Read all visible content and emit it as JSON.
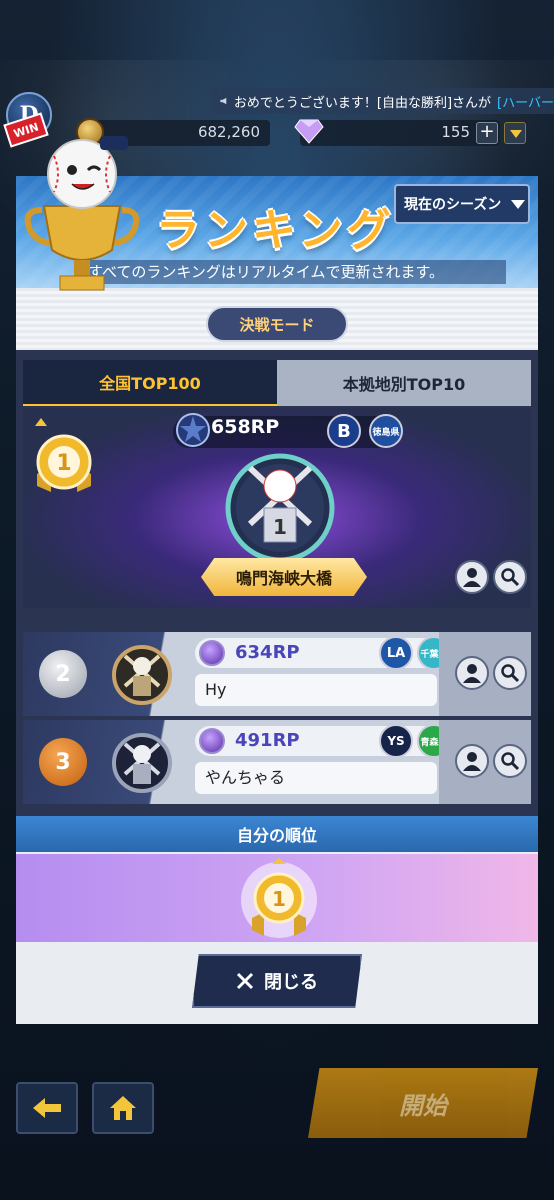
{
  "topbar": {
    "ticker_prefix": "おめでとうございます！[自由な勝利]さんが",
    "ticker_highlight": "[ハーバー",
    "logo_label": "D",
    "win_label": "WIN",
    "coins": "682,260",
    "gems": "155",
    "plus_label": "+"
  },
  "modal": {
    "title": "ランキング",
    "subtitle": "すべてのランキングはリアルタイムで更新されます。",
    "season_label": "現在のシーズン",
    "mode_label": "決戦モード",
    "tabs": [
      {
        "label": "全国TOP100",
        "active": true
      },
      {
        "label": "本拠地別TOP10",
        "active": false
      }
    ],
    "first": {
      "rank": "1",
      "rp": "658RP",
      "name": "鳴門海峡大橋",
      "team": "B",
      "region": "徳島県"
    },
    "rows": [
      {
        "rank": "2",
        "rp": "634RP",
        "name": "Hy",
        "team": "LA",
        "region": "千葉県",
        "color": "#b9bcc4",
        "region_color": "#36b7c7"
      },
      {
        "rank": "3",
        "rp": "491RP",
        "name": "やんちゃる",
        "team": "YS",
        "region": "青森県",
        "color": "#e07b1e",
        "region_color": "#2aa84a"
      }
    ],
    "self_title": "自分の順位",
    "self_rank": "1",
    "close_label": "閉じる"
  },
  "bottom": {
    "start_label": "開始"
  },
  "colors": {
    "accent_gold": "#ffc331",
    "panel_dark": "#2b3552"
  }
}
